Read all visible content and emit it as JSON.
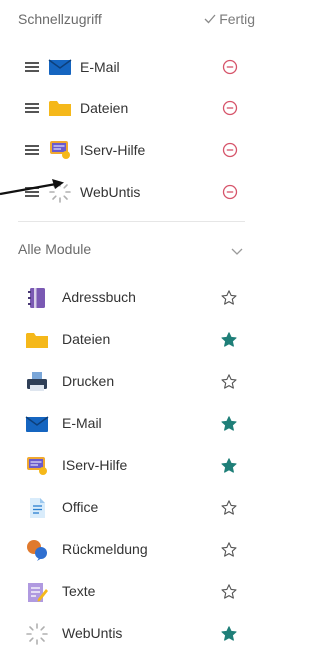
{
  "quick_access": {
    "title": "Schnellzugriff",
    "done_label": "Fertig",
    "items": [
      {
        "label": "E-Mail",
        "icon": "mail-icon"
      },
      {
        "label": "Dateien",
        "icon": "folder-icon"
      },
      {
        "label": "IServ-Hilfe",
        "icon": "help-icon"
      },
      {
        "label": "WebUntis",
        "icon": "webuntis-icon"
      }
    ]
  },
  "all_modules": {
    "title": "Alle Module",
    "items": [
      {
        "label": "Adressbuch",
        "icon": "addressbook-icon",
        "favorite": false
      },
      {
        "label": "Dateien",
        "icon": "folder-icon",
        "favorite": true
      },
      {
        "label": "Drucken",
        "icon": "printer-icon",
        "favorite": false
      },
      {
        "label": "E-Mail",
        "icon": "mail-icon",
        "favorite": true
      },
      {
        "label": "IServ-Hilfe",
        "icon": "help-icon",
        "favorite": true
      },
      {
        "label": "Office",
        "icon": "office-icon",
        "favorite": false
      },
      {
        "label": "Rückmeldung",
        "icon": "feedback-icon",
        "favorite": false
      },
      {
        "label": "Texte",
        "icon": "texts-icon",
        "favorite": false
      },
      {
        "label": "WebUntis",
        "icon": "webuntis-icon",
        "favorite": true
      }
    ]
  },
  "colors": {
    "accent_teal": "#1f7f78",
    "remove_red": "#d6546a",
    "mail_blue": "#1565c0",
    "folder_yellow": "#f5b81a"
  }
}
